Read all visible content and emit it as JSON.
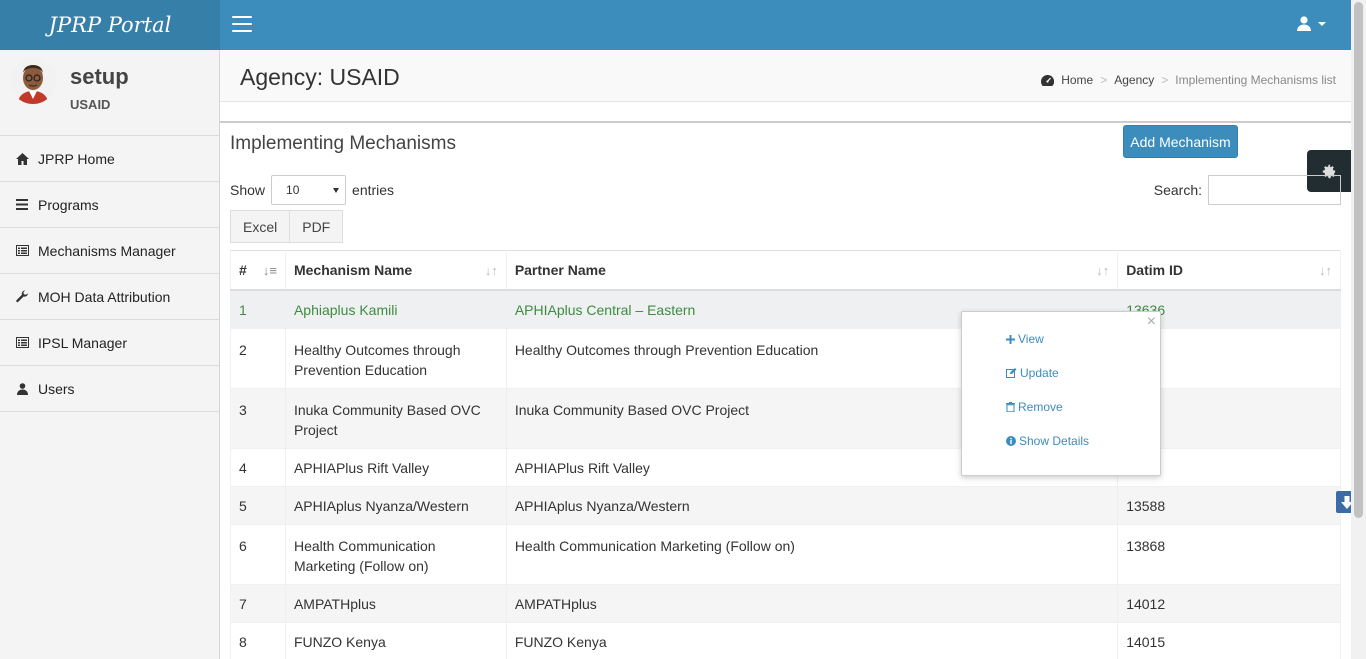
{
  "app": {
    "brand": "JPRP Portal"
  },
  "user": {
    "name": "setup",
    "org": "USAID"
  },
  "sidebar": {
    "items": [
      {
        "label": "JPRP Home",
        "icon": "home-icon"
      },
      {
        "label": "Programs",
        "icon": "list-icon"
      },
      {
        "label": "Mechanisms Manager",
        "icon": "list-alt-icon"
      },
      {
        "label": "MOH Data Attribution",
        "icon": "wrench-icon"
      },
      {
        "label": "IPSL Manager",
        "icon": "list-alt-icon"
      },
      {
        "label": "Users",
        "icon": "user-icon"
      }
    ]
  },
  "header": {
    "title": "Agency: USAID",
    "breadcrumb": [
      "Home",
      "Agency",
      "Implementing Mechanisms list"
    ]
  },
  "box": {
    "title": "Implementing Mechanisms",
    "add_label": "Add Mechanism",
    "show_label": "Show",
    "entries_label": "entries",
    "page_length": "10",
    "search_label": "Search:",
    "search_value": "",
    "export_buttons": [
      "Excel",
      "PDF"
    ]
  },
  "table": {
    "columns": [
      "#",
      "Mechanism Name",
      "Partner Name",
      "Datim ID"
    ],
    "rows": [
      [
        "1",
        "Aphiaplus Kamili",
        "APHIAplus Central – Eastern",
        "13636"
      ],
      [
        "2",
        "Healthy Outcomes through Prevention Education",
        "Healthy Outcomes through Prevention Education",
        ""
      ],
      [
        "3",
        "Inuka Community Based OVC Project",
        "Inuka Community Based OVC Project",
        ""
      ],
      [
        "4",
        "APHIAPlus Rift Valley",
        "APHIAPlus Rift Valley",
        ""
      ],
      [
        "5",
        "APHIAplus Nyanza/Western",
        "APHIAplus Nyanza/Western",
        "13588"
      ],
      [
        "6",
        "Health Communication Marketing (Follow on)",
        "Health Communication Marketing (Follow on)",
        "13868"
      ],
      [
        "7",
        "AMPATHplus",
        "AMPATHplus",
        "14012"
      ],
      [
        "8",
        "FUNZO Kenya",
        "FUNZO Kenya",
        "14015"
      ]
    ]
  },
  "popup": {
    "close": "×",
    "items": [
      "View",
      "Update",
      "Remove",
      "Show Details"
    ]
  },
  "colors": {
    "brand": "#367fa9",
    "topbar": "#3c8dbc",
    "selected_text": "#3d8c40"
  }
}
